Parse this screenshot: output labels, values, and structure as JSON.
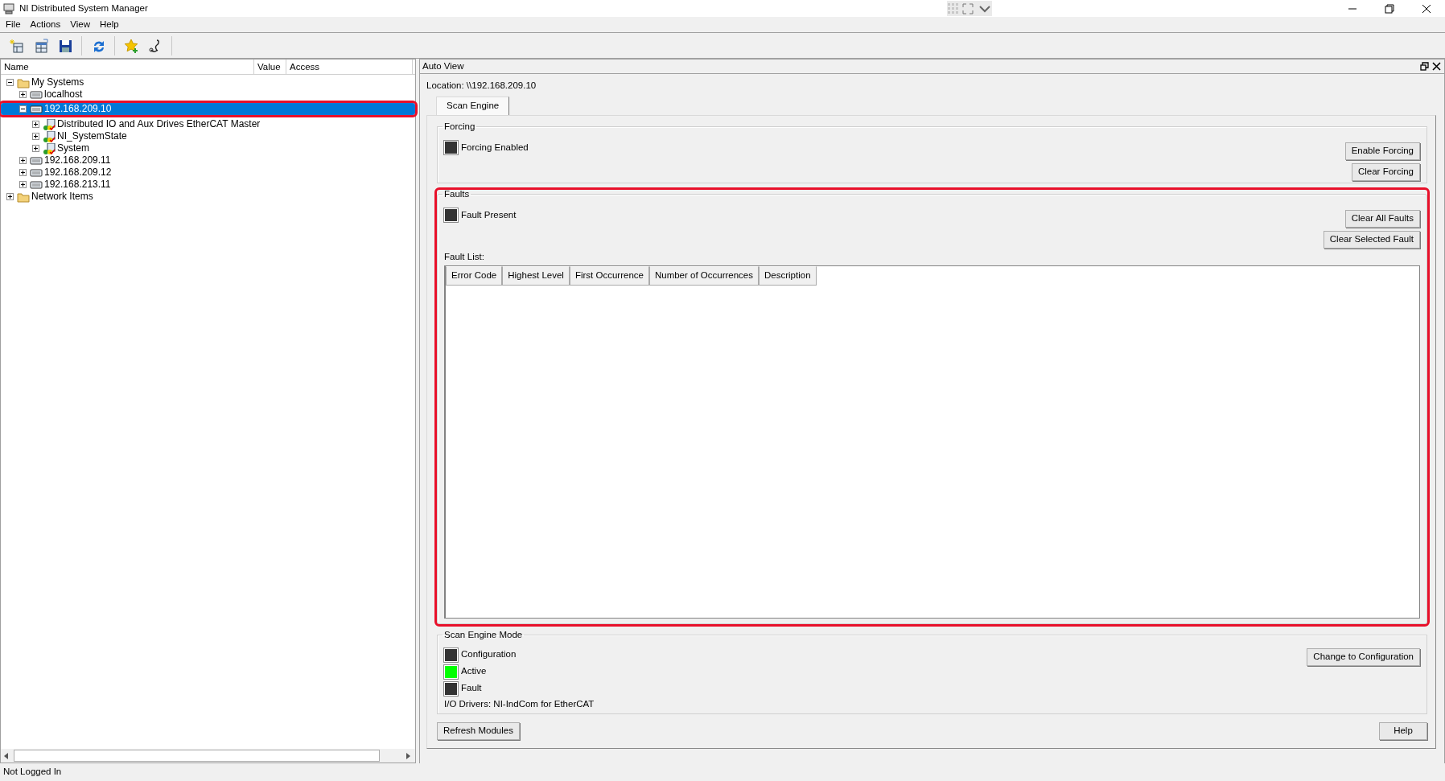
{
  "window": {
    "title": "NI Distributed System Manager"
  },
  "menu": [
    "File",
    "Actions",
    "View",
    "Help"
  ],
  "tree": {
    "columns": [
      "Name",
      "Value",
      "Access"
    ],
    "items": [
      {
        "label": "My Systems",
        "kind": "folder",
        "expanded": true,
        "selected": false,
        "highlighted": false,
        "children": [
          {
            "label": "localhost",
            "kind": "system",
            "expanded": false,
            "selected": false,
            "highlighted": false
          },
          {
            "label": "192.168.209.10",
            "kind": "system",
            "expanded": true,
            "selected": true,
            "highlighted": true,
            "children": [
              {
                "label": "Distributed IO and Aux Drives EtherCAT Master",
                "kind": "target",
                "expanded": false,
                "selected": false,
                "highlighted": false
              },
              {
                "label": "NI_SystemState",
                "kind": "target",
                "expanded": false,
                "selected": false,
                "highlighted": false
              },
              {
                "label": "System",
                "kind": "target",
                "expanded": false,
                "selected": false,
                "highlighted": false
              }
            ]
          },
          {
            "label": "192.168.209.11",
            "kind": "system",
            "expanded": false,
            "selected": false,
            "highlighted": false
          },
          {
            "label": "192.168.209.12",
            "kind": "system",
            "expanded": false,
            "selected": false,
            "highlighted": false
          },
          {
            "label": "192.168.213.11",
            "kind": "system",
            "expanded": false,
            "selected": false,
            "highlighted": false
          }
        ]
      },
      {
        "label": "Network Items",
        "kind": "folder",
        "expanded": false,
        "selected": false,
        "highlighted": false
      }
    ]
  },
  "auto_view": {
    "title": "Auto View",
    "location": "Location: \\\\192.168.209.10",
    "tabs": [
      {
        "label": "Scan Engine",
        "selected": true
      }
    ],
    "forcing": {
      "title": "Forcing",
      "highlighted": false,
      "indicators": [
        {
          "label": "Forcing Enabled",
          "on": false
        }
      ],
      "buttons": [
        "Enable Forcing",
        "Clear Forcing"
      ]
    },
    "faults": {
      "title": "Faults",
      "highlighted": true,
      "indicators": [
        {
          "label": "Fault Present",
          "on": false
        }
      ],
      "buttons": [
        "Clear All Faults",
        "Clear Selected Fault"
      ],
      "list_label": "Fault List:",
      "columns": [
        "Error Code",
        "Highest Level",
        "First Occurrence",
        "Number of Occurrences",
        "Description"
      ]
    },
    "mode": {
      "title": "Scan Engine Mode",
      "indicators": [
        {
          "label": "Configuration",
          "on": false
        },
        {
          "label": "Active",
          "on": true
        },
        {
          "label": "Fault",
          "on": false
        }
      ],
      "drivers": "I/O Drivers: NI-IndCom for EtherCAT",
      "buttons": [
        "Change to Configuration"
      ]
    },
    "buttons": [
      "Refresh Modules",
      "Help"
    ]
  },
  "status_bar": "Not Logged In"
}
